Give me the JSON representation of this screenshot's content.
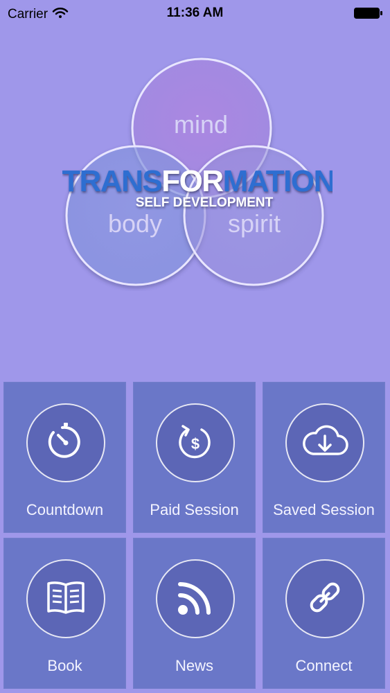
{
  "status_bar": {
    "carrier": "Carrier",
    "time": "11:36 AM",
    "wifi_icon": "wifi-icon",
    "battery_icon": "battery-icon"
  },
  "hero": {
    "circle_labels": {
      "mind": "mind",
      "body": "body",
      "spirit": "spirit"
    },
    "logo": {
      "title": {
        "part1": "TRANS",
        "part2": "FOR",
        "part3": "MATION"
      },
      "subtitle": "SELF DEVELOPMENT"
    }
  },
  "tiles": [
    {
      "label": "Countdown",
      "icon": "timer-icon"
    },
    {
      "label": "Paid Session",
      "icon": "paid-session-icon"
    },
    {
      "label": "Saved Session",
      "icon": "cloud-download-icon"
    },
    {
      "label": "Book",
      "icon": "book-icon"
    },
    {
      "label": "News",
      "icon": "rss-icon"
    },
    {
      "label": "Connect",
      "icon": "link-icon"
    }
  ],
  "colors": {
    "background": "#9f97ea",
    "tile_bg": "#6a77c8",
    "tile_circle_bg": "#5c66b6",
    "logo_blue": "#2f6ed1",
    "logo_white": "#ffffff"
  }
}
